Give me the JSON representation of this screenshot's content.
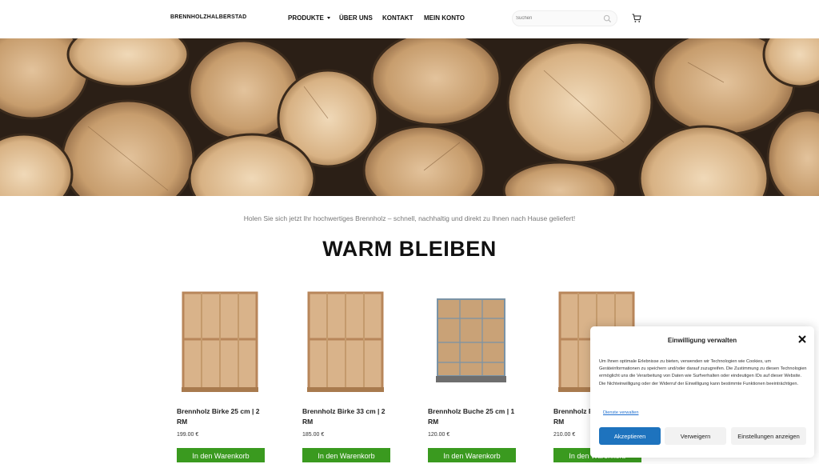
{
  "header": {
    "logo": "BRENNHOLZHALBERSTAD",
    "nav": {
      "produkte": "PRODUKTE",
      "ueber_uns": "ÜBER UNS",
      "kontakt": "KONTAKT",
      "mein_konto": "MEIN KONTO"
    },
    "search_placeholder": "Suchen",
    "icons": {
      "search": "search-icon",
      "cart": "cart-icon"
    }
  },
  "main": {
    "tagline": "Holen Sie sich jetzt Ihr hochwertiges Brennholz – schnell, nachhaltig und direkt zu Ihnen nach Hause geliefert!",
    "heading": "WARM BLEIBEN"
  },
  "products": [
    {
      "title": "Brennholz Birke 25 cm | 2 RM",
      "price": "199.00 €",
      "button": "In den Warenkorb"
    },
    {
      "title": "Brennholz Birke 33 cm | 2 RM",
      "price": "185.00 €",
      "button": "In den Warenkorb"
    },
    {
      "title": "Brennholz Buche 25 cm | 1 RM",
      "price": "120.00 €",
      "button": "In den Warenkorb"
    },
    {
      "title": "Brennholz Birke 33 cm | 1 RM",
      "price": "210.00 €",
      "button": "In den Warenkorb"
    }
  ],
  "consent": {
    "title": "Einwilligung verwalten",
    "body": "Um Ihnen optimale Erlebnisse zu bieten, verwenden wir Technologien wie Cookies, um Geräteinformationen zu speichern und/oder darauf zuzugreifen. Die Zustimmung zu diesen Technologien ermöglicht uns die Verarbeitung von Daten wie Surfverhalten oder eindeutigen IDs auf dieser Website. Die Nichteinwilligung oder der Widerruf der Einwilligung kann bestimmte Funktionen beeinträchtigen.",
    "link": "Dienste verwalten",
    "accept": "Akzeptieren",
    "deny": "Verweigern",
    "settings": "Einstellungen anzeigen"
  },
  "colors": {
    "button_green": "#3a9a1f",
    "accept_blue": "#1e73be",
    "link_blue": "#1e6fd0"
  }
}
